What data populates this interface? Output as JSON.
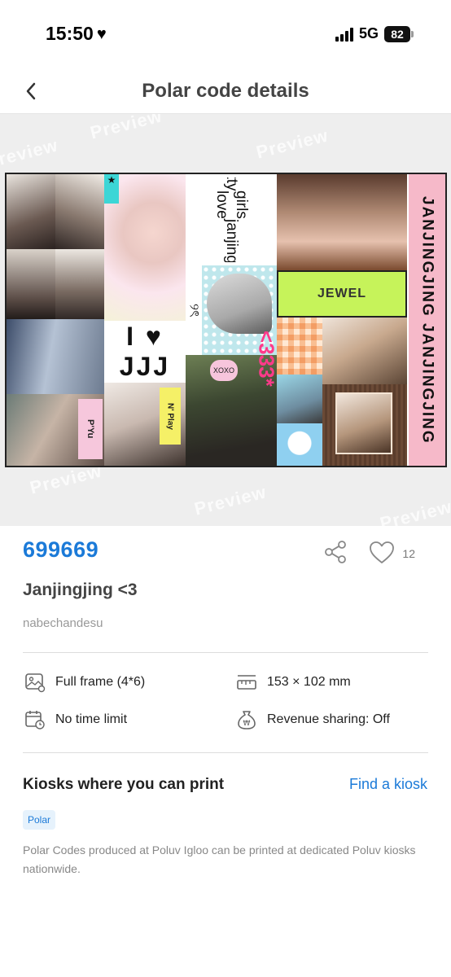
{
  "status_bar": {
    "time": "15:50",
    "network": "5G",
    "battery": "82"
  },
  "header": {
    "title": "Polar code details",
    "back_icon": "chevron-left-icon"
  },
  "preview": {
    "watermark": "Preview",
    "collage_text": {
      "pretty": "pretty",
      "girls_love": "girls love",
      "janjingjing": "janjingjing",
      "jewel": "JEWEL",
      "i_heart_jjj": "I ♥ JJJ",
      "side_banner": "JANJINGJING JANJINGJING",
      "number": "<333*",
      "pyu": "P'Yu",
      "play": "N' Play",
      "xoxo": "XOXO",
      "ke": "୨ৎ"
    }
  },
  "code": {
    "number": "699669",
    "name": "Janjingjing <3",
    "author": "nabechandesu",
    "likes": "12"
  },
  "specs": {
    "frame": "Full frame (4*6)",
    "size": "153 × 102 mm",
    "time": "No time limit",
    "revenue": "Revenue sharing: Off"
  },
  "kiosk": {
    "title": "Kiosks where you can print",
    "find_link": "Find a kiosk",
    "badge": "Polar",
    "description": "Polar Codes produced at Poluv Igloo can be printed at dedicated Poluv kiosks nationwide."
  },
  "colors": {
    "accent": "#1b7ad8",
    "preview_bg": "#eeeeee",
    "jewel_green": "#c6f35a",
    "banner_pink": "#f6b9c9"
  }
}
